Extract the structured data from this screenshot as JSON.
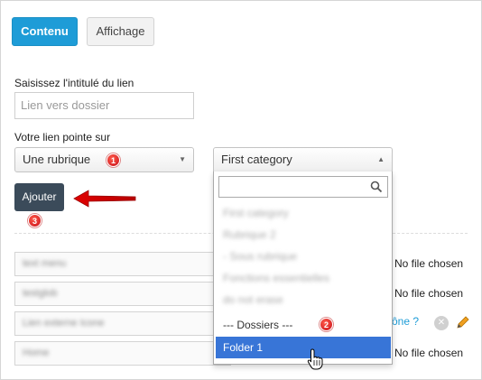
{
  "tabs": {
    "content": "Contenu",
    "display": "Affichage"
  },
  "form": {
    "link_label": "Saisissez l'intitulé du lien",
    "link_placeholder": "Lien vers dossier",
    "target_label": "Votre lien pointe sur",
    "target_select_value": "Une rubrique",
    "category_select_value": "First category",
    "add_button": "Ajouter"
  },
  "badges": {
    "one": "1",
    "two": "2",
    "three": "3"
  },
  "dropdown": {
    "search_value": "",
    "items": [
      "First category",
      "Rubrique 2",
      "- Sous rubrique",
      "Fonctions essentielles",
      "do not erase"
    ],
    "group_label": "--- Dossiers ---",
    "selected_item": "Folder 1"
  },
  "rows": [
    {
      "value": "text menu",
      "file_status": "No file chosen"
    },
    {
      "value": "testglob",
      "file_status": "No file chosen"
    },
    {
      "value": "Lien externe Icone",
      "file_status": "ône ?"
    },
    {
      "value": "Home",
      "file_status": "No file chosen"
    }
  ],
  "colors": {
    "primary": "#1e9cd7",
    "dark_button": "#3b4b5a",
    "selected": "#3875d7",
    "badge_red": "#d21b1b",
    "arrow_red": "#d80000"
  },
  "icons": {
    "search": "search-icon",
    "remove": "close-circle-icon",
    "edit": "pencil-icon",
    "pointer": "hand-cursor-icon"
  }
}
